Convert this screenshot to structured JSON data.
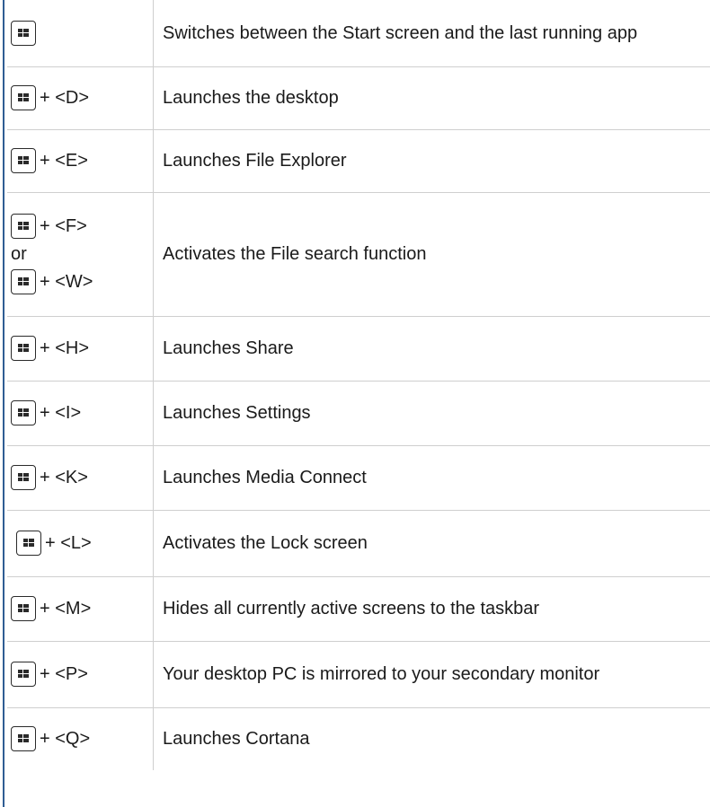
{
  "shortcuts": [
    {
      "keys": [
        ""
      ],
      "or_label": "",
      "description": "Switches between the Start screen and the last running app"
    },
    {
      "keys": [
        "+ <D>"
      ],
      "or_label": "",
      "description": "Launches the desktop"
    },
    {
      "keys": [
        "+ <E>"
      ],
      "or_label": "",
      "description": "Launches File Explorer"
    },
    {
      "keys": [
        "+ <F>",
        "+ <W>"
      ],
      "or_label": "or",
      "description": "Activates the File search function"
    },
    {
      "keys": [
        "+ <H>"
      ],
      "or_label": "",
      "description": "Launches Share"
    },
    {
      "keys": [
        "+ <I>"
      ],
      "or_label": "",
      "description": "Launches Settings"
    },
    {
      "keys": [
        "+ <K>"
      ],
      "or_label": "",
      "description": "Launches Media Connect"
    },
    {
      "keys": [
        "+ <L>"
      ],
      "or_label": "",
      "description": "Activates the Lock screen"
    },
    {
      "keys": [
        "+ <M>"
      ],
      "or_label": "",
      "description": "Hides all currently active screens to the taskbar"
    },
    {
      "keys": [
        "+ <P>"
      ],
      "or_label": "",
      "description": "Your desktop PC is mirrored to your secondary monitor"
    },
    {
      "keys": [
        "+ <Q>"
      ],
      "or_label": "",
      "description": "Launches Cortana"
    }
  ],
  "icons": {
    "windows_key": "windows-key-icon"
  },
  "colors": {
    "accent_rule": "#2f5d93",
    "grid_line": "#cfcfcf",
    "text": "#1a1a1a"
  }
}
